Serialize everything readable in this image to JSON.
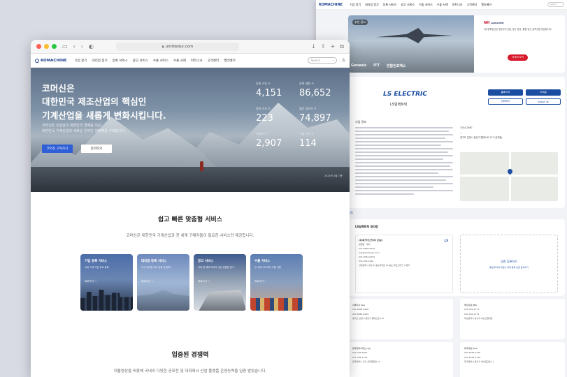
{
  "back": {
    "nav": {
      "logo": "KOMACHINE",
      "items": [
        "기업 찾기",
        "대리점 찾기",
        "등록 서비스",
        "광고 서비스",
        "수출 서비스",
        "수출 사례",
        "파트너사",
        "고객센터",
        "엘리베어"
      ],
      "search_placeholder": "Search"
    },
    "ad": {
      "pill": "추천 광고",
      "sponsors": [
        "Genesis",
        "ITT",
        "연합인포맥스"
      ],
      "brand_a": "NH",
      "brand_b": "LGPACHEM",
      "desc": "(주)한화방산은 항공우주산업, 방산 장비, 통합 방산 솔루션을 제공합니다.",
      "cta": "자세히 보기"
    },
    "company": {
      "logo": "LS ELECTRIC",
      "name": "LS일렉트릭",
      "buttons": [
        "홈페이지",
        "이메일",
        "전화하기",
        "About us"
      ],
      "info_title": "기업 정보",
      "contact": [
        "1544-2080",
        "—",
        "경기도 안양시 동안구 엘에스로 127 (호계동)"
      ]
    },
    "map_label": "지도",
    "partner": {
      "title": "LS일렉트릭 대리점",
      "card_logo": "LS",
      "card_lines": [
        "(주)테크리드코리아 [인증]",
        "영업팀 · 대리",
        "031-8082-0430",
        "info@techlead.co.kr",
        "031-8054-0054",
        "031-625-2240",
        "인천광역시 연수구 송도과학로 32 송도 테크노파크 IT센터"
      ],
      "add_title": "방한 등록하기",
      "add_sub": "총판/지사와 파트너 지위 등록 요청 문의하기"
    },
    "branches": [
      {
        "title": "서울지사 (SL)",
        "lines": [
          "031-8082-0446",
          "031-8082-0445",
          "경기도 안양시 동안구 엘에스로 127"
        ]
      },
      {
        "title": "부산지점 (BS)",
        "lines": [
          "031-544-1771",
          "031-544-1770",
          "부산광역시 강서구 녹산산업대로"
        ]
      },
      {
        "title": "광주연락사무소 (GJ)",
        "lines": [
          "031-395-2505",
          "031-395-2740",
          "광주광역시 서구 상무중앙로 10"
        ]
      },
      {
        "title": "대구지점 (DG)",
        "lines": [
          "031-6582-4145",
          "031-6582-4140",
          "대구광역시 달서구 성서공단로 11"
        ]
      }
    ]
  },
  "front": {
    "chrome": {
      "url": "untitledui.com"
    },
    "nav": {
      "logo": "KOMACHINE",
      "items": [
        "기업 찾기",
        "대리점 찾기",
        "등록 서비스",
        "광고 서비스",
        "수출 서비스",
        "수출 사례",
        "파트너사",
        "고객센터",
        "엘리베어"
      ],
      "search_placeholder": "Search"
    },
    "hero": {
      "title_lines": [
        "코머신은",
        "대한민국 제조산업의 핵심인",
        "기계산업을 새롭게 변화시킵니다."
      ],
      "sub_lines": [
        "코머신은 오늘날의 대한민국 경제를 이끈,",
        "대한민국 기계산업의 새로운 온라인 생태계를 구축합니다."
      ],
      "btn_primary": "코머신 구독하기",
      "btn_secondary": "문의하기",
      "stats": [
        {
          "label": "등록 기업 수",
          "value": "4,151"
        },
        {
          "label": "등록 제품 수",
          "value": "86,652"
        },
        {
          "label": "협력 국가 수",
          "value": "223"
        },
        {
          "label": "월간 접속자 수",
          "value": "74,897"
        },
        {
          "label": "거래국 수",
          "value": "2,907"
        },
        {
          "label": "수출 국가 수",
          "value": "114"
        }
      ],
      "note": "2023년 1월 기준"
    },
    "services": {
      "title": "쉽고 빠른 맞춤형 서비스",
      "subtitle": "코머신은 대한민국 기계산업과 전 세계 구매자들이 필요한 서비스만 제공합니다.",
      "cards": [
        {
          "title": "기업 등록 서비스",
          "desc": "국내 기계 기업 무료 등록",
          "more": "바로가기 →"
        },
        {
          "title": "대리점 등록 서비스",
          "desc": "우수 대리점 무료 등록 및 협력",
          "more": "바로가기 →"
        },
        {
          "title": "광고 서비스",
          "desc": "국내 및 해외 바이어 대상 맞춤형 광고",
          "more": "바로가기 →"
        },
        {
          "title": "수출 서비스",
          "desc": "전 세계 190개국 수출 지원",
          "more": "바로가기 →"
        }
      ]
    },
    "competitive": {
      "title": "입증된 경쟁력",
      "subtitle": "대통령상을 비롯해 국내의 다양한 공모전 및 대회에서 산업 플랫폼 운영능력을 입증 받았습니다."
    }
  }
}
